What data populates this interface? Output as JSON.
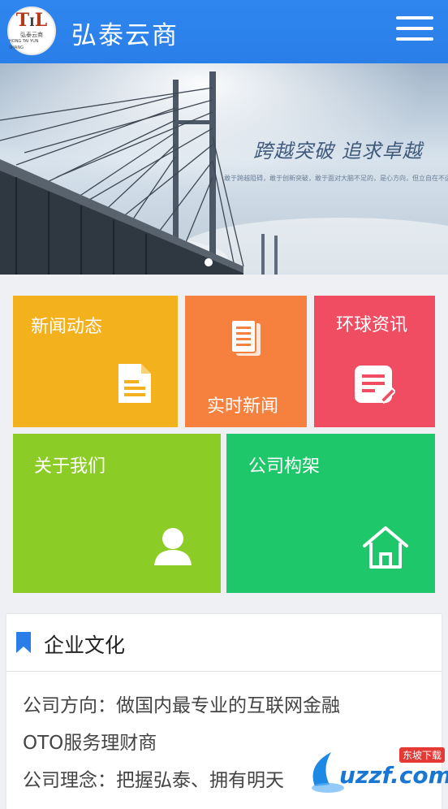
{
  "header": {
    "title": "弘泰云商",
    "logo_text": "弘泰云商",
    "logo_subtext": "HONG TAI YUN SHANG"
  },
  "banner": {
    "slogan": "跨越突破 追求卓越",
    "subslogan": "敢于跨越阻碍，敢于创新突破，敢于面对大脑不足的，是心方向，但立自在不运的"
  },
  "tiles": {
    "news": "新闻动态",
    "realtime": "实时新闻",
    "global": "环球资讯",
    "about": "关于我们",
    "org": "公司构架"
  },
  "culture": {
    "title": "企业文化",
    "line1": "公司方向：做国内最专业的互联网金融",
    "line2": "OTO服务理财商",
    "line3": "公司理念：把握弘泰、拥有明天"
  },
  "watermark": {
    "brand": "uzzf.com",
    "tag": "东坡下载"
  },
  "colors": {
    "header": "#2f86ee",
    "news": "#f3b21d",
    "realtime": "#f6813e",
    "global": "#f04d63",
    "about": "#8ccc26",
    "org": "#1ec769",
    "bookmark": "#2a7ee8"
  },
  "icons": {
    "menu": "hamburger-menu-icon",
    "news": "document-icon",
    "realtime": "newspaper-icon",
    "global": "note-edit-icon",
    "about": "user-icon",
    "org": "home-icon",
    "culture": "bookmark-icon"
  }
}
